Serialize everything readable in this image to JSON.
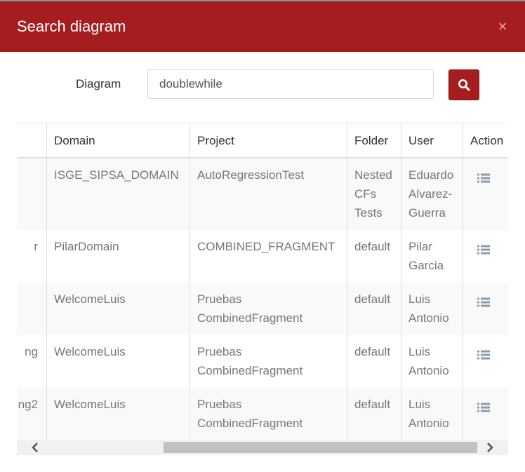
{
  "header": {
    "title": "Search diagram",
    "close_glyph": "×"
  },
  "search": {
    "label": "Diagram",
    "value": "doublewhile"
  },
  "colors": {
    "brand": "#a51d1f",
    "row_alt": "#f9f9f9"
  },
  "table": {
    "columns": [
      "Domain",
      "Project",
      "Folder",
      "User",
      "Action"
    ],
    "rows": [
      {
        "partial": "",
        "domain": "ISGE_SIPSA_DOMAIN",
        "project": "AutoRegressionTest",
        "folder": "Nested CFs Tests",
        "user": "Eduardo Alvarez-Guerra",
        "action_icon": "list-icon"
      },
      {
        "partial": "r",
        "domain": "PilarDomain",
        "project": "COMBINED_FRAGMENT",
        "folder": "default",
        "user": "Pilar Garcia",
        "action_icon": "list-icon"
      },
      {
        "partial": "",
        "domain": "WelcomeLuis",
        "project": "Pruebas CombinedFragment",
        "folder": "default",
        "user": "Luis Antonio",
        "action_icon": "list-icon"
      },
      {
        "partial": "ng",
        "domain": "WelcomeLuis",
        "project": "Pruebas CombinedFragment",
        "folder": "default",
        "user": "Luis Antonio",
        "action_icon": "list-icon"
      },
      {
        "partial": "ng2",
        "domain": "WelcomeLuis",
        "project": "Pruebas CombinedFragment",
        "folder": "default",
        "user": "Luis Antonio",
        "action_icon": "list-icon"
      }
    ]
  },
  "scrollbar": {
    "icons": [
      "chevron-left-icon",
      "chevron-right-icon"
    ]
  }
}
